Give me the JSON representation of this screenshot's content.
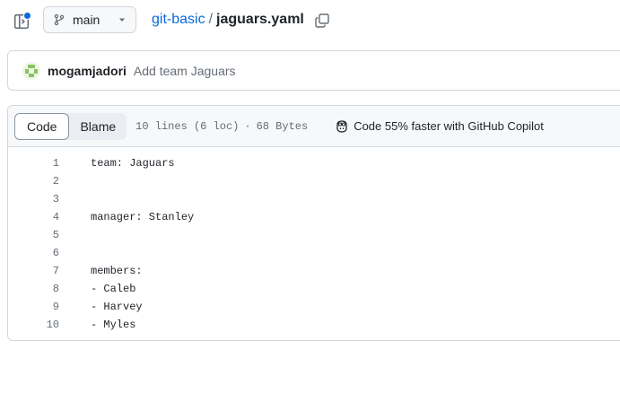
{
  "header": {
    "branch": "main",
    "repo": "git-basic",
    "separator": "/",
    "file": "jaguars.yaml"
  },
  "commit": {
    "author": "mogamjadori",
    "message": "Add team Jaguars"
  },
  "file_view": {
    "tabs": [
      {
        "label": "Code",
        "active": true
      },
      {
        "label": "Blame",
        "active": false
      }
    ],
    "lines_info": "10 lines (6 loc)",
    "dot": "·",
    "size": "68 Bytes",
    "copilot_text": "Code 55% faster with GitHub Copilot"
  },
  "code": {
    "lines": [
      {
        "num": "1",
        "text": "team: Jaguars"
      },
      {
        "num": "2",
        "text": ""
      },
      {
        "num": "3",
        "text": ""
      },
      {
        "num": "4",
        "text": "manager: Stanley"
      },
      {
        "num": "5",
        "text": ""
      },
      {
        "num": "6",
        "text": ""
      },
      {
        "num": "7",
        "text": "members:"
      },
      {
        "num": "8",
        "text": "- Caleb"
      },
      {
        "num": "9",
        "text": "- Harvey"
      },
      {
        "num": "10",
        "text": "- Myles"
      }
    ]
  },
  "colors": {
    "link": "#0969da",
    "muted": "#656d76",
    "border": "#d0d7de",
    "notification_dot": "#0969da"
  }
}
